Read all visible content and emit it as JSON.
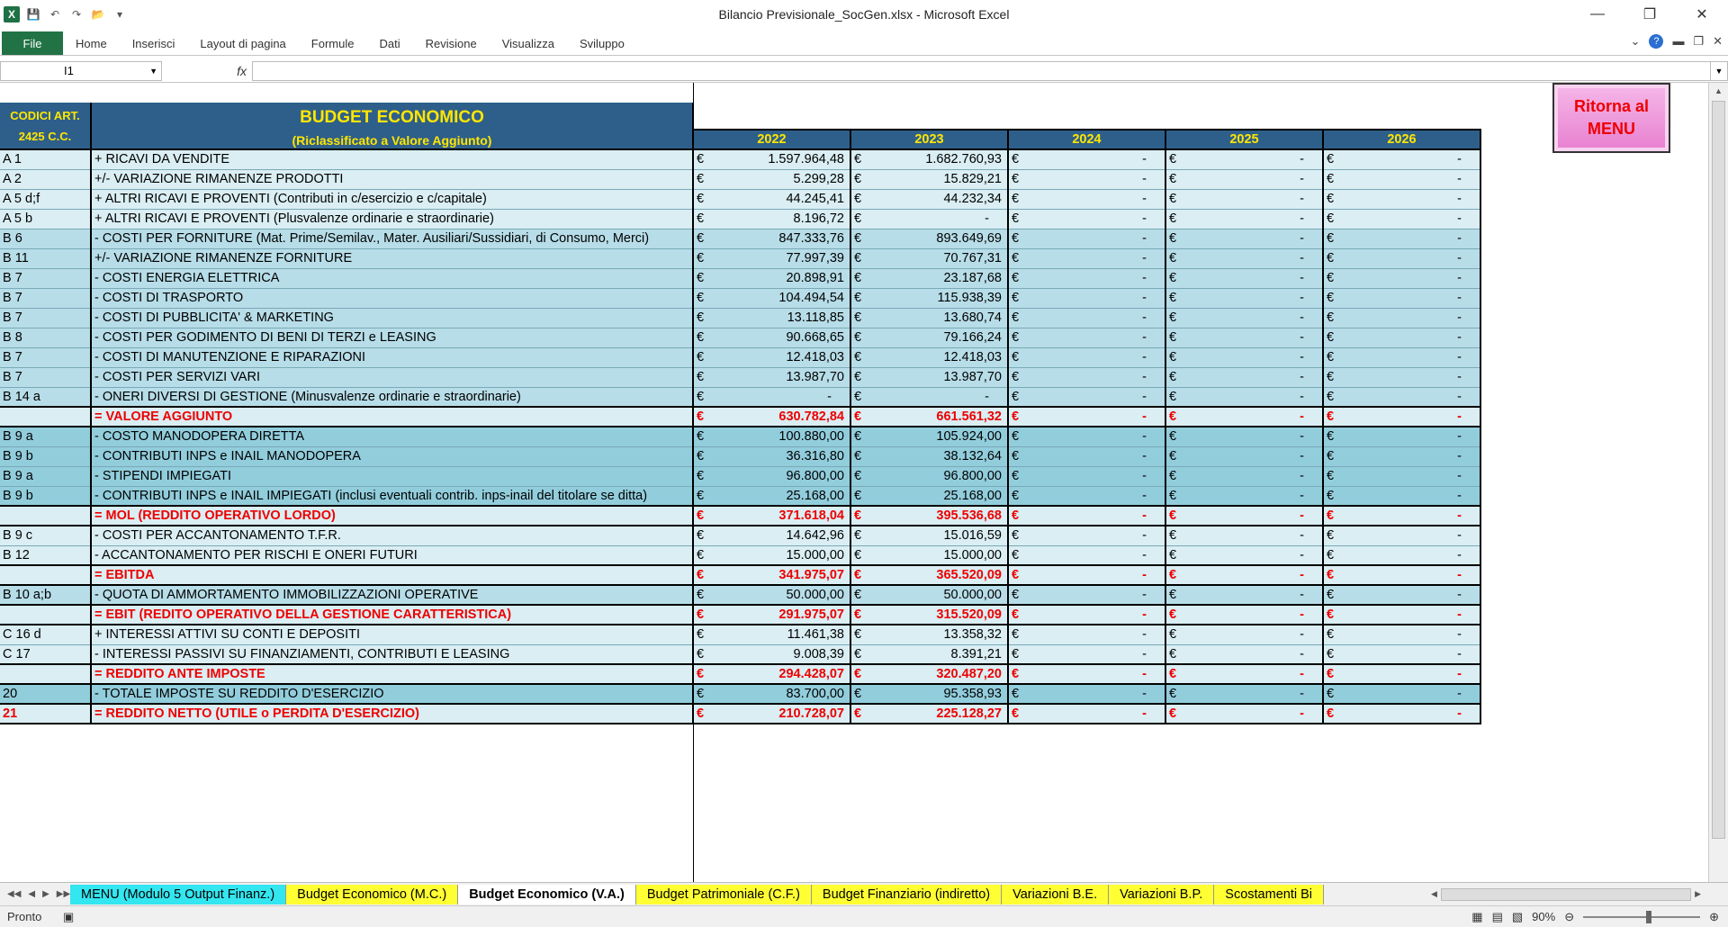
{
  "window": {
    "title": "Bilancio Previsionale_SocGen.xlsx - Microsoft Excel"
  },
  "ribbon": {
    "file": "File",
    "tabs": [
      "Home",
      "Inserisci",
      "Layout di pagina",
      "Formule",
      "Dati",
      "Revisione",
      "Visualizza",
      "Sviluppo"
    ]
  },
  "formula_bar": {
    "name_box": "I1",
    "fx": "fx",
    "value": ""
  },
  "header": {
    "codes": "CODICI ART. 2425 C.C.",
    "title": "BUDGET ECONOMICO",
    "subtitle": "(Riclassificato a Valore Aggiunto)",
    "years": [
      "2022",
      "2023",
      "2024",
      "2025",
      "2026"
    ]
  },
  "menu_button": {
    "label": "Ritorna al MENU"
  },
  "currency": "€",
  "rows": [
    {
      "code": "A 1",
      "desc": "+ RICAVI DA VENDITE",
      "v": [
        "1.597.964,48",
        "1.682.760,93",
        "-",
        "-",
        "-"
      ],
      "style": "s1"
    },
    {
      "code": "A 2",
      "desc": "+/- VARIAZIONE RIMANENZE PRODOTTI",
      "v": [
        "5.299,28",
        "15.829,21",
        "-",
        "-",
        "-"
      ],
      "style": "s1"
    },
    {
      "code": "A 5 d;f",
      "desc": "+ ALTRI RICAVI E PROVENTI (Contributi in c/esercizio e c/capitale)",
      "v": [
        "44.245,41",
        "44.232,34",
        "-",
        "-",
        "-"
      ],
      "style": "s1"
    },
    {
      "code": "A 5 b",
      "desc": "+ ALTRI RICAVI E PROVENTI (Plusvalenze ordinarie e straordinarie)",
      "v": [
        "8.196,72",
        "-",
        "-",
        "-",
        "-"
      ],
      "style": "s1"
    },
    {
      "code": "B 6",
      "desc": "- COSTI PER FORNITURE (Mat. Prime/Semilav., Mater. Ausiliari/Sussidiari, di Consumo, Merci)",
      "v": [
        "847.333,76",
        "893.649,69",
        "-",
        "-",
        "-"
      ],
      "style": "s2"
    },
    {
      "code": "B 11",
      "desc": "+/- VARIAZIONE RIMANENZE FORNITURE",
      "v": [
        "77.997,39",
        "70.767,31",
        "-",
        "-",
        "-"
      ],
      "style": "s2"
    },
    {
      "code": "B 7",
      "desc": "- COSTI ENERGIA ELETTRICA",
      "v": [
        "20.898,91",
        "23.187,68",
        "-",
        "-",
        "-"
      ],
      "style": "s2"
    },
    {
      "code": "B 7",
      "desc": "- COSTI DI TRASPORTO",
      "v": [
        "104.494,54",
        "115.938,39",
        "-",
        "-",
        "-"
      ],
      "style": "s2"
    },
    {
      "code": "B 7",
      "desc": "- COSTI DI PUBBLICITA' & MARKETING",
      "v": [
        "13.118,85",
        "13.680,74",
        "-",
        "-",
        "-"
      ],
      "style": "s2"
    },
    {
      "code": "B 8",
      "desc": "- COSTI PER GODIMENTO DI BENI DI TERZI e LEASING",
      "v": [
        "90.668,65",
        "79.166,24",
        "-",
        "-",
        "-"
      ],
      "style": "s2"
    },
    {
      "code": "B 7",
      "desc": "- COSTI DI MANUTENZIONE E RIPARAZIONI",
      "v": [
        "12.418,03",
        "12.418,03",
        "-",
        "-",
        "-"
      ],
      "style": "s2"
    },
    {
      "code": "B 7",
      "desc": "- COSTI PER SERVIZI VARI",
      "v": [
        "13.987,70",
        "13.987,70",
        "-",
        "-",
        "-"
      ],
      "style": "s2"
    },
    {
      "code": "B 14 a",
      "desc": "- ONERI DIVERSI DI GESTIONE (Minusvalenze ordinarie e straordinarie)",
      "v": [
        "-",
        "-",
        "-",
        "-",
        "-"
      ],
      "style": "s2"
    },
    {
      "code": "",
      "desc": "= VALORE AGGIUNTO",
      "v": [
        "630.782,84",
        "661.561,32",
        "-",
        "-",
        "-"
      ],
      "style": "tot"
    },
    {
      "code": "B 9 a",
      "desc": "- COSTO MANODOPERA DIRETTA",
      "v": [
        "100.880,00",
        "105.924,00",
        "-",
        "-",
        "-"
      ],
      "style": "s3"
    },
    {
      "code": "B 9 b",
      "desc": "- CONTRIBUTI INPS e INAIL MANODOPERA",
      "v": [
        "36.316,80",
        "38.132,64",
        "-",
        "-",
        "-"
      ],
      "style": "s3"
    },
    {
      "code": "B 9 a",
      "desc": "- STIPENDI IMPIEGATI",
      "v": [
        "96.800,00",
        "96.800,00",
        "-",
        "-",
        "-"
      ],
      "style": "s3"
    },
    {
      "code": "B 9 b",
      "desc": "- CONTRIBUTI INPS e INAIL IMPIEGATI (inclusi eventuali contrib. inps-inail del titolare se ditta)",
      "v": [
        "25.168,00",
        "25.168,00",
        "-",
        "-",
        "-"
      ],
      "style": "s3"
    },
    {
      "code": "",
      "desc": "= MOL (REDDITO OPERATIVO LORDO)",
      "v": [
        "371.618,04",
        "395.536,68",
        "-",
        "-",
        "-"
      ],
      "style": "tot"
    },
    {
      "code": "B 9 c",
      "desc": "- COSTI PER ACCANTONAMENTO T.F.R.",
      "v": [
        "14.642,96",
        "15.016,59",
        "-",
        "-",
        "-"
      ],
      "style": "s1"
    },
    {
      "code": "B 12",
      "desc": "- ACCANTONAMENTO PER RISCHI E ONERI FUTURI",
      "v": [
        "15.000,00",
        "15.000,00",
        "-",
        "-",
        "-"
      ],
      "style": "s1"
    },
    {
      "code": "",
      "desc": "= EBITDA",
      "v": [
        "341.975,07",
        "365.520,09",
        "-",
        "-",
        "-"
      ],
      "style": "tot"
    },
    {
      "code": "B 10 a;b",
      "desc": "- QUOTA DI AMMORTAMENTO IMMOBILIZZAZIONI OPERATIVE",
      "v": [
        "50.000,00",
        "50.000,00",
        "-",
        "-",
        "-"
      ],
      "style": "s2"
    },
    {
      "code": "",
      "desc": "= EBIT (REDITO OPERATIVO DELLA GESTIONE CARATTERISTICA)",
      "v": [
        "291.975,07",
        "315.520,09",
        "-",
        "-",
        "-"
      ],
      "style": "tot"
    },
    {
      "code": "C 16 d",
      "desc": "+ INTERESSI ATTIVI SU CONTI E DEPOSITI",
      "v": [
        "11.461,38",
        "13.358,32",
        "-",
        "-",
        "-"
      ],
      "style": "s1"
    },
    {
      "code": "C 17",
      "desc": "- INTERESSI PASSIVI SU FINANZIAMENTI, CONTRIBUTI E LEASING",
      "v": [
        "9.008,39",
        "8.391,21",
        "-",
        "-",
        "-"
      ],
      "style": "s1"
    },
    {
      "code": "",
      "desc": "= REDDITO ANTE IMPOSTE",
      "v": [
        "294.428,07",
        "320.487,20",
        "-",
        "-",
        "-"
      ],
      "style": "tot"
    },
    {
      "code": "20",
      "desc": "- TOTALE IMPOSTE SU REDDITO D'ESERCIZIO",
      "v": [
        "83.700,00",
        "95.358,93",
        "-",
        "-",
        "-"
      ],
      "style": "s3"
    },
    {
      "code": "21",
      "desc": "= REDDITO NETTO (UTILE o PERDITA D'ESERCIZIO)",
      "v": [
        "210.728,07",
        "225.128,27",
        "-",
        "-",
        "-"
      ],
      "style": "tot"
    }
  ],
  "sheet_tabs": [
    {
      "label": "MENU (Modulo 5 Output Finanz.)",
      "style": "cyan"
    },
    {
      "label": "Budget Economico (M.C.)",
      "style": "yel"
    },
    {
      "label": "Budget Economico (V.A.)",
      "style": "act"
    },
    {
      "label": "Budget Patrimoniale (C.F.)",
      "style": "yel"
    },
    {
      "label": "Budget Finanziario (indiretto)",
      "style": "yel"
    },
    {
      "label": "Variazioni B.E.",
      "style": "yel"
    },
    {
      "label": "Variazioni B.P.",
      "style": "yel"
    },
    {
      "label": "Scostamenti Bi",
      "style": "yel"
    }
  ],
  "status": {
    "ready": "Pronto",
    "zoom": "90%"
  },
  "colors": {
    "header_bg": "#2e5f8a",
    "header_text": "#ffe600",
    "total_text": "#ee0000",
    "excel_green": "#217346"
  }
}
